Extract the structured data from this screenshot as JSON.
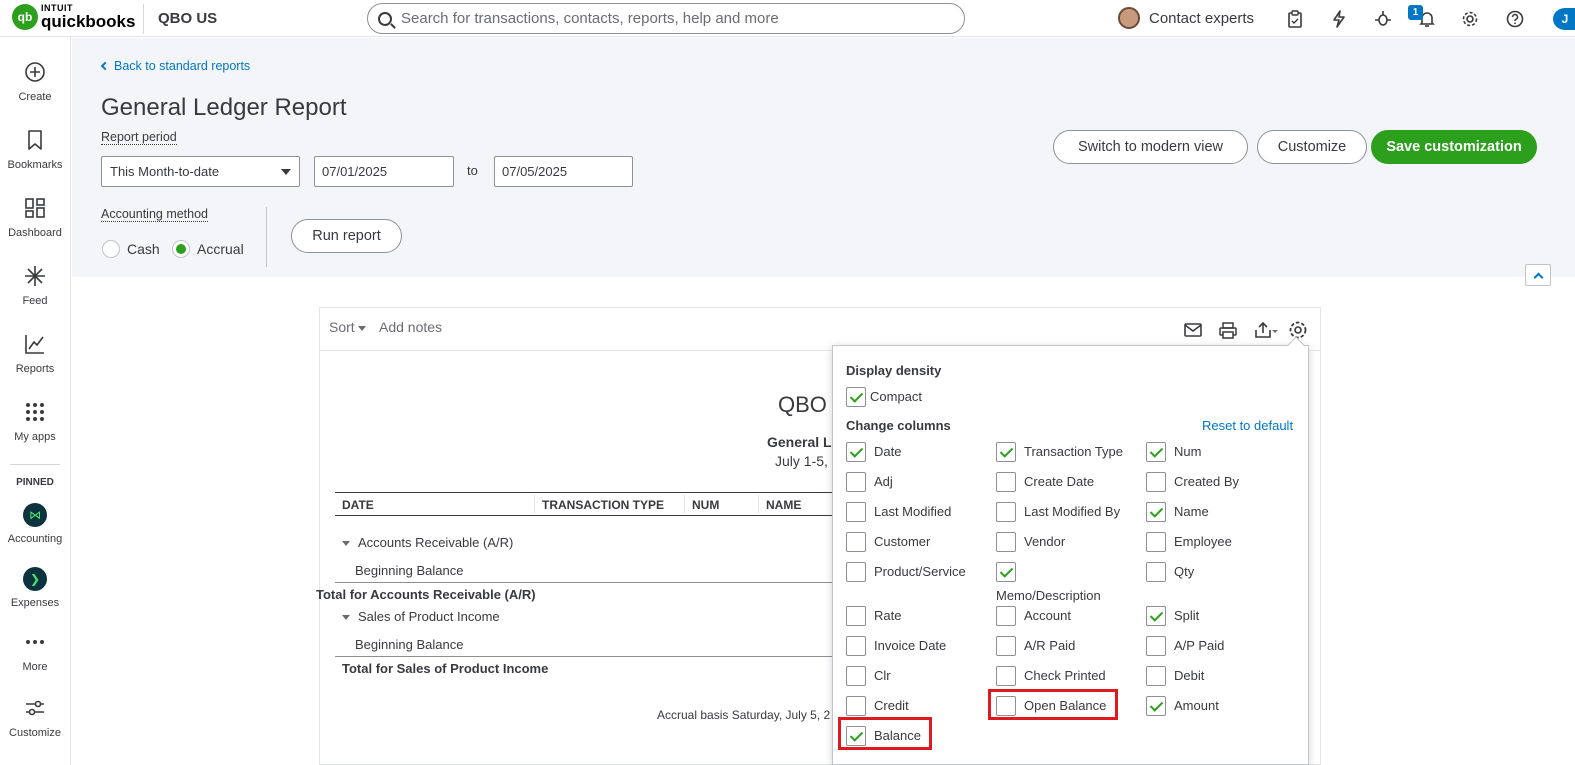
{
  "topbar": {
    "logo_mark": "qb",
    "logo_intuit": "INTUIT",
    "logo_name": "quickbooks",
    "company": "QBO US",
    "search_placeholder": "Search for transactions, contacts, reports, help and more",
    "contact_experts": "Contact experts",
    "notification_count": "1",
    "user_initial": "J",
    "icons": [
      "clipboard-icon",
      "lightning-icon",
      "bug-icon",
      "bell-icon",
      "gear-icon",
      "help-icon"
    ]
  },
  "leftnav": {
    "items": [
      {
        "label": "Create",
        "icon": "plus-circle-icon"
      },
      {
        "label": "Bookmarks",
        "icon": "bookmark-icon"
      },
      {
        "label": "Dashboard",
        "icon": "grid-icon"
      },
      {
        "label": "Feed",
        "icon": "sparkle-icon"
      },
      {
        "label": "Reports",
        "icon": "chart-line-icon"
      },
      {
        "label": "My apps",
        "icon": "apps-grid-icon"
      }
    ],
    "pinned_label": "PINNED",
    "pinned": [
      {
        "label": "Accounting",
        "icon": "accounting-icon"
      },
      {
        "label": "Expenses",
        "icon": "expenses-icon"
      }
    ],
    "more": "More",
    "customize": "Customize"
  },
  "header": {
    "back_link": "Back to standard reports",
    "title": "General Ledger Report",
    "report_period_label": "Report period",
    "period_value": "This Month-to-date",
    "date_from": "07/01/2025",
    "to_label": "to",
    "date_to": "07/05/2025",
    "accounting_method_label": "Accounting method",
    "methods": [
      {
        "label": "Cash",
        "selected": false
      },
      {
        "label": "Accrual",
        "selected": true
      }
    ],
    "run_report": "Run report",
    "switch_modern": "Switch to modern view",
    "customize": "Customize",
    "save_customization": "Save customization"
  },
  "report": {
    "sort": "Sort",
    "add_notes": "Add notes",
    "company": "QBO",
    "name": "General L",
    "range": "July 1-5,",
    "columns": [
      "DATE",
      "TRANSACTION TYPE",
      "NUM",
      "NAME"
    ],
    "rows": [
      {
        "text": "Accounts Receivable (A/R)",
        "kind": "group"
      },
      {
        "text": "Beginning Balance",
        "kind": "item"
      },
      {
        "text": "Total for Accounts Receivable (A/R)",
        "kind": "total"
      },
      {
        "text": "Sales of Product Income",
        "kind": "group"
      },
      {
        "text": "Beginning Balance",
        "kind": "item"
      },
      {
        "text": "Total for Sales of Product Income",
        "kind": "total"
      }
    ],
    "footer": "Accrual basis   Saturday, July 5, 2"
  },
  "settings_popover": {
    "display_density_label": "Display density",
    "compact": {
      "label": "Compact",
      "checked": true
    },
    "change_columns_label": "Change columns",
    "reset_to_default": "Reset to default",
    "columns": [
      [
        {
          "label": "Date",
          "checked": true
        },
        {
          "label": "Transaction Type",
          "checked": true
        },
        {
          "label": "Num",
          "checked": true
        }
      ],
      [
        {
          "label": "Adj",
          "checked": false
        },
        {
          "label": "Create Date",
          "checked": false
        },
        {
          "label": "Created By",
          "checked": false
        }
      ],
      [
        {
          "label": "Last Modified",
          "checked": false
        },
        {
          "label": "Last Modified By",
          "checked": false
        },
        {
          "label": "Name",
          "checked": true
        }
      ],
      [
        {
          "label": "Customer",
          "checked": false
        },
        {
          "label": "Vendor",
          "checked": false
        },
        {
          "label": "Employee",
          "checked": false
        }
      ],
      [
        {
          "label": "Product/Service",
          "checked": false
        },
        {
          "label": "Memo/Description",
          "checked": true
        },
        {
          "label": "Qty",
          "checked": false
        }
      ],
      [
        {
          "label": "Rate",
          "checked": false
        },
        {
          "label": "Account",
          "checked": false
        },
        {
          "label": "Split",
          "checked": true
        }
      ],
      [
        {
          "label": "Invoice Date",
          "checked": false
        },
        {
          "label": "A/R Paid",
          "checked": false
        },
        {
          "label": "A/P Paid",
          "checked": false
        }
      ],
      [
        {
          "label": "Clr",
          "checked": false
        },
        {
          "label": "Check Printed",
          "checked": false
        },
        {
          "label": "Debit",
          "checked": false
        }
      ],
      [
        {
          "label": "Credit",
          "checked": false
        },
        {
          "label": "Open Balance",
          "checked": false
        },
        {
          "label": "Amount",
          "checked": true
        }
      ],
      [
        {
          "label": "Balance",
          "checked": true
        }
      ]
    ],
    "highlight_color": "#e0191f"
  },
  "colors": {
    "brand_green": "#2ca01c",
    "link_blue": "#0077c5",
    "header_bg": "#f4f5f8"
  }
}
